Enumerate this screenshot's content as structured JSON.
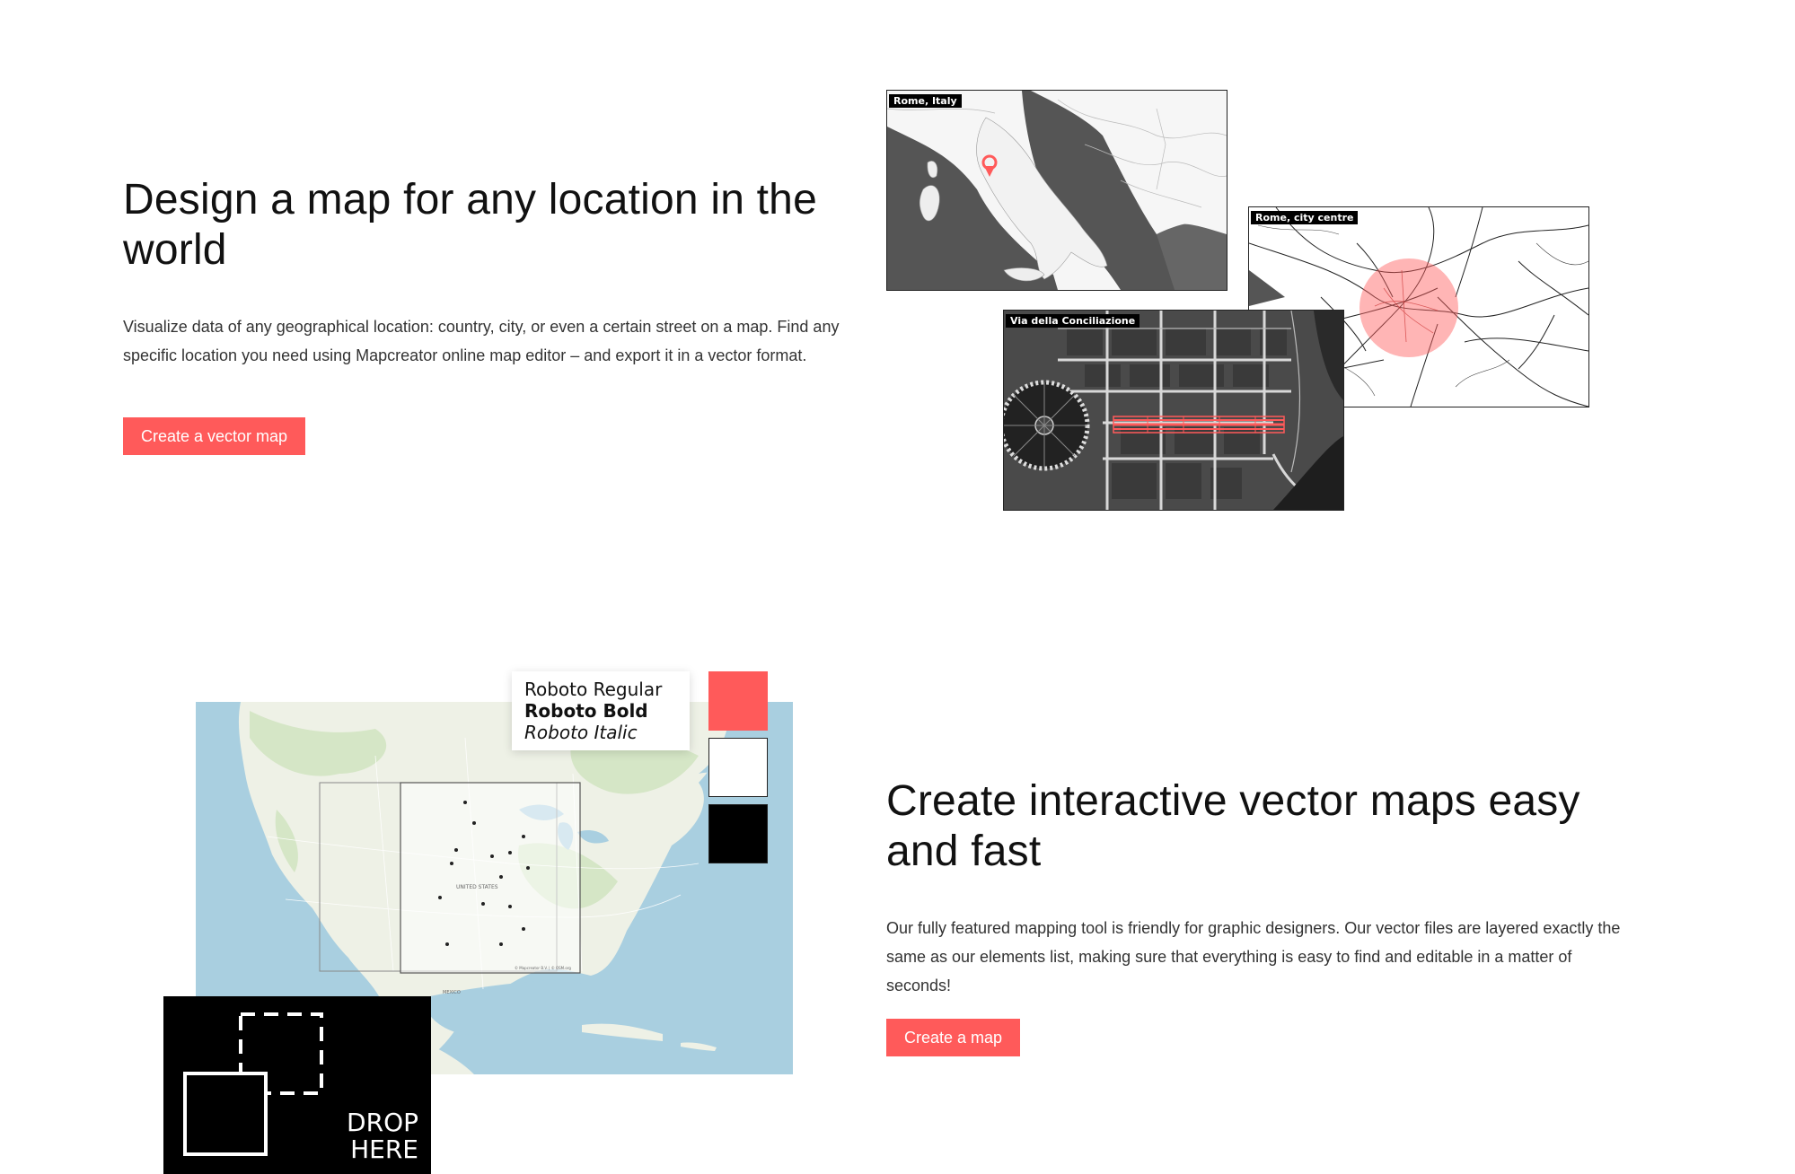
{
  "section1": {
    "heading": "Design a map for any location in the world",
    "body": "Visualize data of any geographical location: country, city, or even a certain street on a map. Find any specific location you need using Mapcreator online map editor – and export it in a vector format.",
    "button_label": "Create a vector map",
    "maps": {
      "country_label": "Rome, Italy",
      "city_label": "Rome, city centre",
      "street_label": "Via della Conciliazione"
    }
  },
  "section2": {
    "heading": "Create interactive vector maps easy and fast",
    "body": "Our fully featured mapping tool is friendly for graphic designers. Our vector files are layered exactly the same as our elements list, making sure that everything is easy to find and editable in a matter of seconds!",
    "button_label": "Create a map",
    "fonts": {
      "regular": "Roboto Regular",
      "bold": "Roboto Bold",
      "italic": "Roboto Italic"
    },
    "swatches": [
      "#ff5a5a",
      "#ffffff",
      "#000000"
    ],
    "drop_zone": {
      "line1": "DROP",
      "line2": "HERE"
    },
    "map_labels": {
      "country": "UNITED STATES",
      "mexico": "MEXICO",
      "attribution": "© Mapcreator B.V. | © OSM.org"
    }
  },
  "colors": {
    "accent": "#ff5a5a",
    "water": "#a9cfe0",
    "land": "#eef1e6",
    "dark_land": "#555555"
  }
}
